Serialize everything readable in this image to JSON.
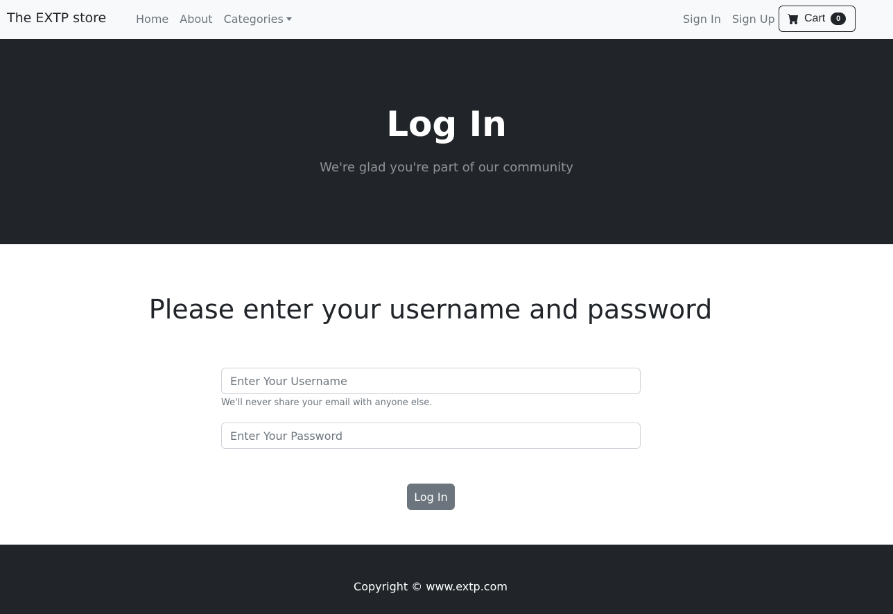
{
  "navbar": {
    "brand": "The EXTP store",
    "links": [
      {
        "label": "Home"
      },
      {
        "label": "About"
      },
      {
        "label": "Categories"
      }
    ],
    "sign_in": "Sign In",
    "sign_up": "Sign Up",
    "cart": {
      "label": "Cart",
      "count": "0",
      "icon": "cart-icon"
    }
  },
  "hero": {
    "title": "Log In",
    "subtitle": "We're glad you're part of our community"
  },
  "form": {
    "heading": "Please enter your username and password",
    "username_placeholder": "Enter Your Username",
    "username_help": "We'll never share your email with anyone else.",
    "password_placeholder": "Enter Your Password",
    "submit_label": "Log In"
  },
  "footer": {
    "copyright": "Copyright © www.extp.com"
  },
  "colors": {
    "dark": "#212529",
    "navbar_bg": "#f8f9fa",
    "muted": "#6c757d"
  }
}
